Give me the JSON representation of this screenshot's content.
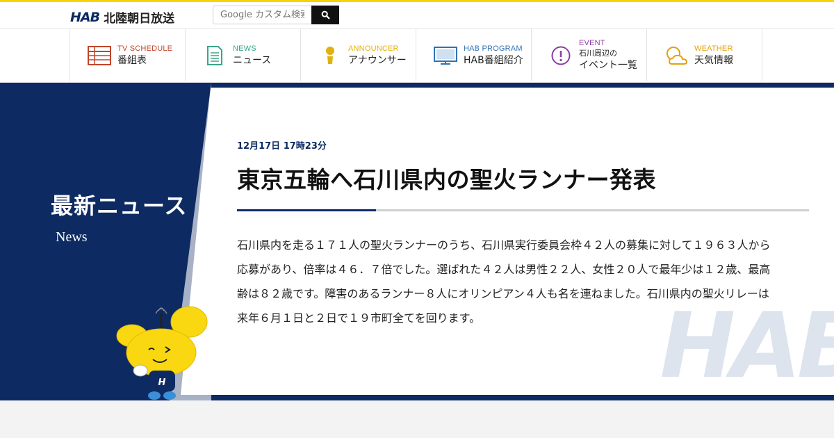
{
  "header": {
    "logo_mark": "HAB",
    "logo_text": "北陸朝日放送",
    "search": {
      "placeholder": "Google カスタム検索",
      "icon": "search-icon"
    }
  },
  "nav": [
    {
      "en": "TV SCHEDULE",
      "ja": "番組表",
      "icon": "schedule-table-icon",
      "color": "#c0452b"
    },
    {
      "en": "NEWS",
      "ja": "ニュース",
      "icon": "document-icon",
      "color": "#3aa58a"
    },
    {
      "en": "ANNOUNCER",
      "ja": "アナウンサー",
      "icon": "person-icon",
      "color": "#e3b10d"
    },
    {
      "en": "HAB PROGRAM",
      "ja": "HAB番組紹介",
      "icon": "monitor-icon",
      "color": "#2f73b5"
    },
    {
      "en": "EVENT",
      "ja_line1": "石川周辺の",
      "ja_line2": "イベント一覧",
      "icon": "exclamation-icon",
      "color": "#8e3da6"
    },
    {
      "en": "WEATHER",
      "ja": "天気情報",
      "icon": "weather-icon",
      "color": "#e3a10d"
    }
  ],
  "section": {
    "title": "最新ニュース",
    "subtitle": "News"
  },
  "article": {
    "date": "12月17日 17時23分",
    "headline": "東京五輪へ石川県内の聖火ランナー発表",
    "body": "石川県内を走る１７１人の聖火ランナーのうち、石川県実行委員会枠４２人の募集に対して１９６３人から応募があり、倍率は４６．７倍でした。選ばれた４２人は男性２２人、女性２０人で最年少は１２歳、最高齢は８２歳です。障害のあるランナー８人にオリンピアン４人も名を連ねました。石川県内の聖火リレーは来年６月１日と２日で１９市町全てを回ります。"
  },
  "watermark": "HAB",
  "colors": {
    "navy": "#0d2a62",
    "yellow": "#f5d40a"
  }
}
